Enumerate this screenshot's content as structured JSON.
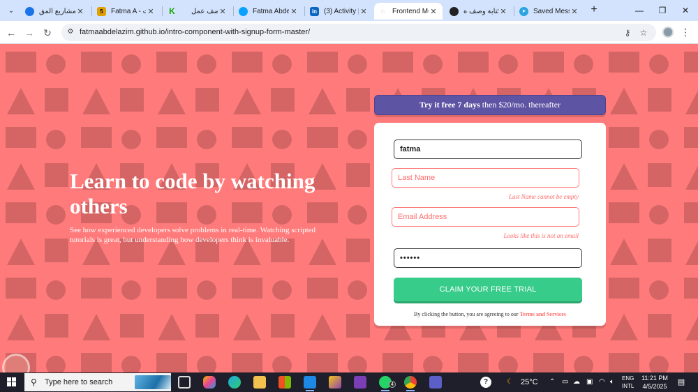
{
  "browser": {
    "tabs": [
      {
        "label": "المشاريع المق",
        "favicon": "spinner-icon",
        "color": "#1a73e8"
      },
      {
        "label": "Fatma A - ث.",
        "favicon": "5",
        "color": "#e0a100"
      },
      {
        "label": "أضف عمل",
        "favicon": "K",
        "color": "#14a800"
      },
      {
        "label": "Fatma Abde",
        "favicon": "ring-icon",
        "color": "#0aa1ff"
      },
      {
        "label": "(3) Activity |",
        "favicon": "in",
        "color": "#0a66c2"
      },
      {
        "label": "Frontend Me",
        "favicon": "ring-icon",
        "color": "#6b6b6b",
        "active": true
      },
      {
        "label": "كتابة وصف ه",
        "favicon": "openai-icon",
        "color": "#222222"
      },
      {
        "label": "Saved Messa",
        "favicon": "telegram-icon",
        "color": "#2aa3e0"
      }
    ],
    "new_tab": "+",
    "window": {
      "minimize": "—",
      "restore": "❐",
      "close": "✕"
    },
    "url": "fatmaabdelazim.github.io/intro-component-with-signup-form-master/"
  },
  "hero": {
    "title": "Learn to code by watching others",
    "text": "See how experienced developers solve problems in real-time. Watching scripted tutorials is great, but understanding how developers think is invaluable."
  },
  "promo": {
    "bold": "Try it free 7 days",
    "rest": " then $20/mo. thereafter"
  },
  "form": {
    "first_name": "fatma",
    "last_name_placeholder": "Last Name",
    "last_name_error": "Last Name cannot be empty",
    "email_placeholder": "Email Address",
    "email_error": "Looks like this is not an email",
    "password": "••••••",
    "submit": "CLAIM YOUR FREE TRIAL",
    "terms_prefix": "By clicking the button, you are agreeing to our ",
    "terms_link": "Terms and Services"
  },
  "taskbar": {
    "search_placeholder": "Type here to search",
    "whatsapp_badge": "4",
    "weather": "25°C",
    "lang_line1": "ENG",
    "lang_line2": "INTL",
    "time": "11:21 PM",
    "date": "4/5/2025"
  },
  "colors": {
    "page_bg": "#ff7a7a",
    "promo_bg": "#5e54a4",
    "cta_bg": "#38cc8b",
    "error": "#ff6b6b"
  }
}
